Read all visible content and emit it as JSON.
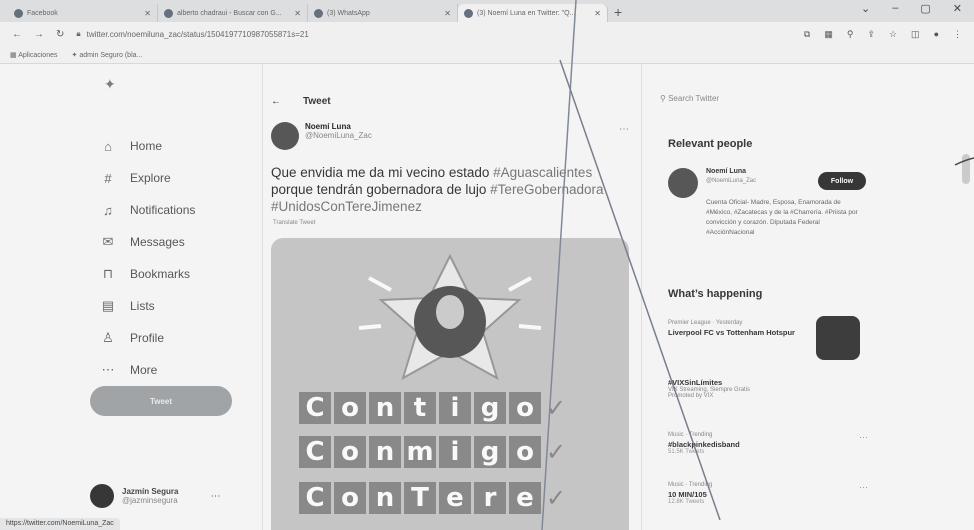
{
  "browser": {
    "tabs": [
      {
        "title": "Facebook",
        "active": false
      },
      {
        "title": "alberto chadraui - Buscar con G...",
        "active": false
      },
      {
        "title": "(3) WhatsApp",
        "active": false
      },
      {
        "title": "(3) Noemí Luna en Twitter: \"Q...",
        "active": true
      }
    ],
    "new_tab": "+",
    "window_controls": [
      "⌄",
      "–",
      "▢",
      "✕"
    ],
    "url": "twitter.com/noemiluna_zac/status/1504197710987055871s=21",
    "bookmarks": [
      "Aplicaciones",
      "admin Seguro (bla..."
    ]
  },
  "sidebar": {
    "items": [
      {
        "icon": "home-icon",
        "glyph": "⌂",
        "label": "Home"
      },
      {
        "icon": "hashtag-icon",
        "glyph": "#",
        "label": "Explore"
      },
      {
        "icon": "bell-icon",
        "glyph": "♫",
        "label": "Notifications"
      },
      {
        "icon": "mail-icon",
        "glyph": "✉",
        "label": "Messages"
      },
      {
        "icon": "bookmark-icon",
        "glyph": "⊓",
        "label": "Bookmarks"
      },
      {
        "icon": "list-icon",
        "glyph": "▤",
        "label": "Lists"
      },
      {
        "icon": "person-icon",
        "glyph": "♙",
        "label": "Profile"
      },
      {
        "icon": "more-icon",
        "glyph": "⋯",
        "label": "More"
      }
    ],
    "tweet_button": "Tweet",
    "user_name": "Jazmín Segura",
    "user_handle": "@jazminsegura"
  },
  "tweet": {
    "header": "Tweet",
    "author_name": "Noemí Luna",
    "author_handle": "@NoemiLuna_Zac",
    "text_plain": "Que envidia me da mi vecino estado ",
    "hashtag1": "#Aguascalientes",
    "text_plain2": " porque tendrán gobernadora de lujo ",
    "hashtag2": "#TereGobernadora",
    "hashtag3": "#UnidosConTereJimenez",
    "translate": "Translate Tweet",
    "image_lines": [
      "Contigo",
      "Conmigo",
      "ConTere"
    ]
  },
  "right": {
    "search_placeholder": "Search Twitter",
    "relevant_title": "Relevant people",
    "person_name": "Noemí Luna",
    "person_handle": "@NoemiLuna_Zac",
    "follow_label": "Follow",
    "person_bio": "Cuenta Oficial- Madre, Esposa, Enamorada de #México, #Zacatecas y de la #Charrería. #Priista por convicción y corazón. Diputada Federal #AcciónNacional",
    "happening_title": "What’s happening",
    "trends": [
      {
        "meta": "Premier League · Yesterday",
        "title": "Liverpool FC vs Tottenham Hotspur",
        "count": ""
      },
      {
        "meta": "",
        "title": "#VIXSinLímites",
        "count": "VIX Streaming, Siempre Gratis"
      },
      {
        "meta": "Music · Trending",
        "title": "#blackpinkedisband",
        "count": "51.5K Tweets"
      },
      {
        "meta": "Music · Trending",
        "title": "10 MIN/105",
        "count": "12.8K Tweets"
      }
    ],
    "promoted": "Promoted by VIX"
  },
  "status_url": "https://twitter.com/NoemiLuna_Zac"
}
